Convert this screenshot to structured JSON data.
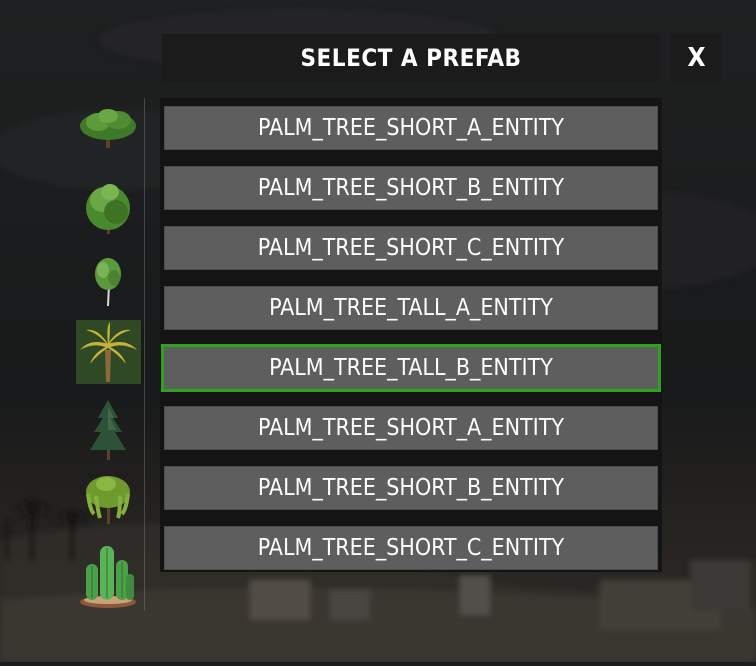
{
  "dialog": {
    "title": "SELECT A PREFAB",
    "close_label": "X",
    "selected_color": "#2fa11c"
  },
  "categories": [
    {
      "icon": "broadleaf-tree-icon",
      "selected": false
    },
    {
      "icon": "bushy-tree-icon",
      "selected": false
    },
    {
      "icon": "small-tree-icon",
      "selected": false
    },
    {
      "icon": "palm-tree-icon",
      "selected": true
    },
    {
      "icon": "pine-tree-icon",
      "selected": false
    },
    {
      "icon": "willow-tree-icon",
      "selected": false
    },
    {
      "icon": "cactus-icon",
      "selected": false
    }
  ],
  "prefabs": [
    {
      "label": "PALM_TREE_SHORT_A_ENTITY",
      "selected": false
    },
    {
      "label": "PALM_TREE_SHORT_B_ENTITY",
      "selected": false
    },
    {
      "label": "PALM_TREE_SHORT_C_ENTITY",
      "selected": false
    },
    {
      "label": "PALM_TREE_TALL_A_ENTITY",
      "selected": false
    },
    {
      "label": "PALM_TREE_TALL_B_ENTITY",
      "selected": true
    },
    {
      "label": "PALM_TREE_SHORT_A_ENTITY",
      "selected": false
    },
    {
      "label": "PALM_TREE_SHORT_B_ENTITY",
      "selected": false
    },
    {
      "label": "PALM_TREE_SHORT_C_ENTITY",
      "selected": false
    }
  ]
}
